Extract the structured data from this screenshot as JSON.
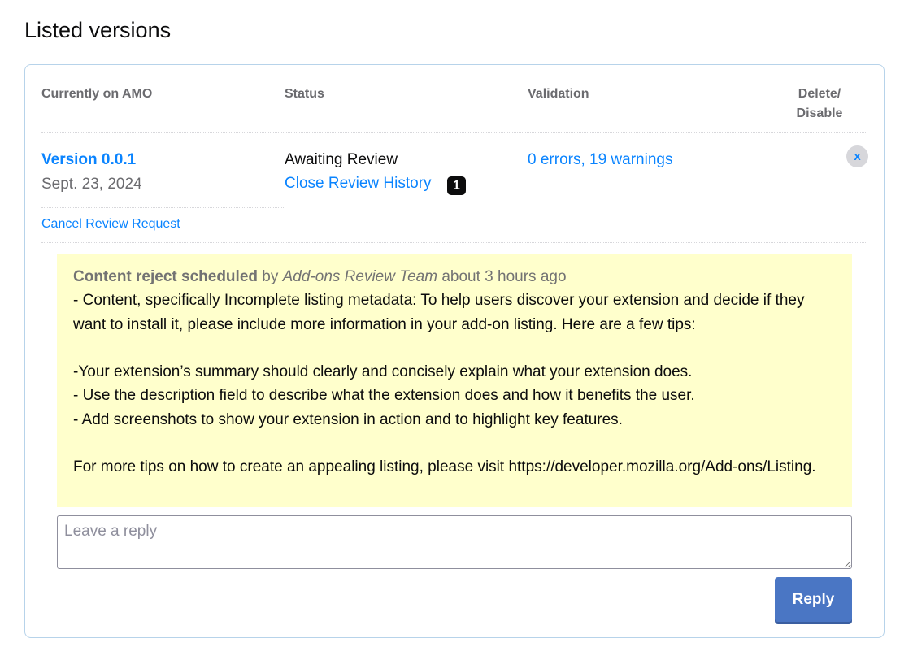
{
  "page": {
    "title": "Listed versions"
  },
  "table": {
    "headers": {
      "amo": "Currently on AMO",
      "status": "Status",
      "validation": "Validation",
      "delete_line1": "Delete/",
      "delete_line2": "Disable"
    },
    "row": {
      "version": "Version 0.0.1",
      "date": "Sept. 23, 2024",
      "status": "Awaiting Review",
      "history_link": "Close Review History",
      "history_count": "1",
      "validation": "0 errors, 19 warnings",
      "delete_label": "x",
      "cancel_link": "Cancel Review Request"
    }
  },
  "history": {
    "action": "Content reject scheduled",
    "by": " by ",
    "author": "Add-ons Review Team",
    "when": " about 3 hours ago",
    "lines": [
      "- Content, specifically Incomplete listing metadata: To help users discover your extension and decide if they want to install it, please include more information in your add-on listing. Here are a few tips:",
      "",
      "-Your extension’s summary should clearly and concisely explain what your extension does.",
      "- Use the description field to describe what the extension does and how it benefits the user.",
      "- Add screenshots to show your extension in action and to highlight key features.",
      "",
      "For more tips on how to create an appealing listing, please visit https://developer.mozilla.org/Add-ons/Listing."
    ]
  },
  "reply": {
    "placeholder": "Leave a reply",
    "button_label": "Reply"
  },
  "colors": {
    "link": "#0a84ff",
    "history_bg": "#ffffcc",
    "reply_button": "#4a76c4",
    "card_border": "#b7d3ea"
  }
}
